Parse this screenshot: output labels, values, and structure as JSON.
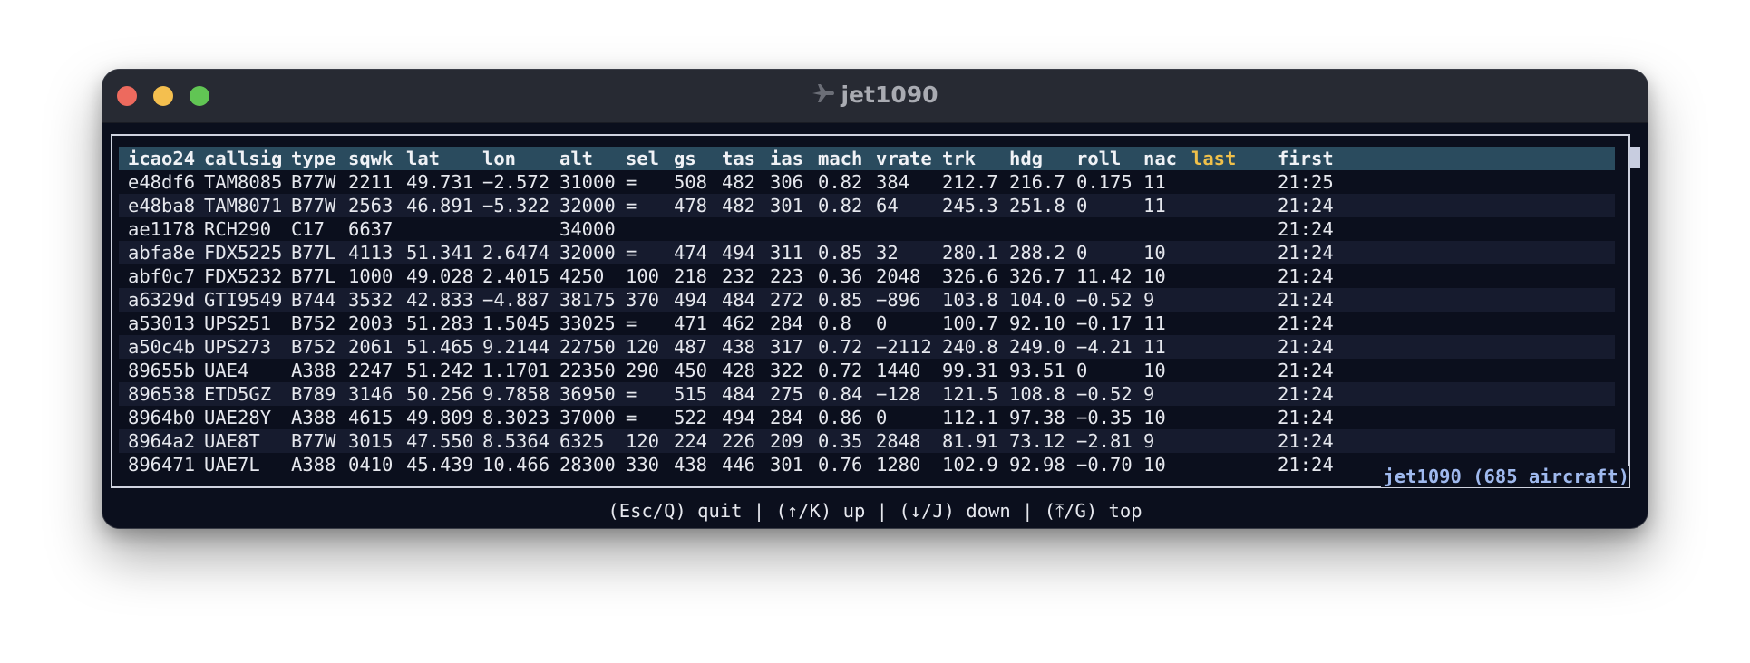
{
  "window": {
    "title": "jet1090"
  },
  "columns": [
    "icao24",
    "callsig",
    "type",
    "sqwk",
    "lat",
    "lon",
    "alt",
    "sel",
    "gs",
    "tas",
    "ias",
    "mach",
    "vrate",
    "trk",
    "hdg",
    "roll",
    "nac",
    "last",
    "first"
  ],
  "rows": [
    [
      "e48df6",
      "TAM8085",
      "B77W",
      "2211",
      "49.731",
      "−2.572",
      "31000",
      "=",
      "508",
      "482",
      "306",
      "0.82",
      "384",
      "212.7",
      "216.7",
      "0.175",
      "11",
      "",
      "21:25"
    ],
    [
      "e48ba8",
      "TAM8071",
      "B77W",
      "2563",
      "46.891",
      "−5.322",
      "32000",
      "=",
      "478",
      "482",
      "301",
      "0.82",
      "64",
      "245.3",
      "251.8",
      "0",
      "11",
      "",
      "21:24"
    ],
    [
      "ae1178",
      "RCH290",
      "C17",
      "6637",
      "",
      "",
      "34000",
      "",
      "",
      "",
      "",
      "",
      "",
      "",
      "",
      "",
      "",
      "",
      "21:24"
    ],
    [
      "abfa8e",
      "FDX5225",
      "B77L",
      "4113",
      "51.341",
      "2.6474",
      "32000",
      "=",
      "474",
      "494",
      "311",
      "0.85",
      "32",
      "280.1",
      "288.2",
      "0",
      "10",
      "",
      "21:24"
    ],
    [
      "abf0c7",
      "FDX5232",
      "B77L",
      "1000",
      "49.028",
      "2.4015",
      "4250",
      "100",
      "218",
      "232",
      "223",
      "0.36",
      "2048",
      "326.6",
      "326.7",
      "11.42",
      "10",
      "",
      "21:24"
    ],
    [
      "a6329d",
      "GTI9549",
      "B744",
      "3532",
      "42.833",
      "−4.887",
      "38175",
      "370",
      "494",
      "484",
      "272",
      "0.85",
      "−896",
      "103.8",
      "104.0",
      "−0.52",
      "9",
      "",
      "21:24"
    ],
    [
      "a53013",
      "UPS251",
      "B752",
      "2003",
      "51.283",
      "1.5045",
      "33025",
      "=",
      "471",
      "462",
      "284",
      "0.8",
      "0",
      "100.7",
      "92.10",
      "−0.17",
      "11",
      "",
      "21:24"
    ],
    [
      "a50c4b",
      "UPS273",
      "B752",
      "2061",
      "51.465",
      "9.2144",
      "22750",
      "120",
      "487",
      "438",
      "317",
      "0.72",
      "−2112",
      "240.8",
      "249.0",
      "−4.21",
      "11",
      "",
      "21:24"
    ],
    [
      "89655b",
      "UAE4",
      "A388",
      "2247",
      "51.242",
      "1.1701",
      "22350",
      "290",
      "450",
      "428",
      "322",
      "0.72",
      "1440",
      "99.31",
      "93.51",
      "0",
      "10",
      "",
      "21:24"
    ],
    [
      "896538",
      "ETD5GZ",
      "B789",
      "3146",
      "50.256",
      "9.7858",
      "36950",
      "=",
      "515",
      "484",
      "275",
      "0.84",
      "−128",
      "121.5",
      "108.8",
      "−0.52",
      "9",
      "",
      "21:24"
    ],
    [
      "8964b0",
      "UAE28Y",
      "A388",
      "4615",
      "49.809",
      "8.3023",
      "37000",
      "=",
      "522",
      "494",
      "284",
      "0.86",
      "0",
      "112.1",
      "97.38",
      "−0.35",
      "10",
      "",
      "21:24"
    ],
    [
      "8964a2",
      "UAE8T",
      "B77W",
      "3015",
      "47.550",
      "8.5364",
      "6325",
      "120",
      "224",
      "226",
      "209",
      "0.35",
      "2848",
      "81.91",
      "73.12",
      "−2.81",
      "9",
      "",
      "21:24"
    ],
    [
      "896471",
      "UAE7L",
      "A388",
      "0410",
      "45.439",
      "10.466",
      "28300",
      "330",
      "438",
      "446",
      "301",
      "0.76",
      "1280",
      "102.9",
      "92.98",
      "−0.70",
      "10",
      "",
      "21:24"
    ]
  ],
  "status": "jet1090 (685 aircraft)",
  "help": "(Esc/Q) quit | (↑/K) up | (↓/J) down | (⤒/G) top",
  "colors": {
    "header_bg": "#2a4b5e",
    "last_col": "#f0c04a",
    "status": "#9fb9ee"
  }
}
